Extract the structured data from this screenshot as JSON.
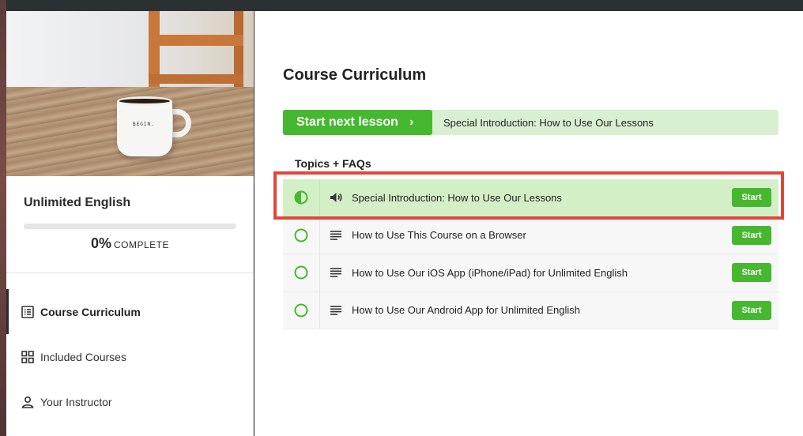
{
  "sidebar": {
    "cover_text": "BEGIN.",
    "course_title": "Unlimited English",
    "progress": {
      "percent": 0,
      "percent_label": "0%",
      "label": "COMPLETE"
    },
    "nav": [
      {
        "label": "Course Curriculum",
        "icon": "list-icon",
        "active": true
      },
      {
        "label": "Included Courses",
        "icon": "grid-icon",
        "active": false
      },
      {
        "label": "Your Instructor",
        "icon": "person-icon",
        "active": false
      }
    ]
  },
  "main": {
    "title": "Course Curriculum",
    "next": {
      "button_label": "Start next lesson",
      "chevron": "›",
      "lesson_title": "Special Introduction: How to Use Our Lessons"
    },
    "section_title": "Topics + FAQs",
    "lessons": [
      {
        "title": "Special Introduction: How to Use Our Lessons",
        "type": "audio-icon",
        "status": "in-progress",
        "button": "Start"
      },
      {
        "title": "How to Use This Course on a Browser",
        "type": "text-icon",
        "status": "not-started",
        "button": "Start"
      },
      {
        "title": "How to Use Our iOS App (iPhone/iPad) for Unlimited English",
        "type": "text-icon",
        "status": "not-started",
        "button": "Start"
      },
      {
        "title": "How to Use Our Android App for Unlimited English",
        "type": "text-icon",
        "status": "not-started",
        "button": "Start"
      }
    ]
  },
  "colors": {
    "accent": "#46b830",
    "highlight": "#e2463a",
    "current_row": "#d3efc6"
  }
}
